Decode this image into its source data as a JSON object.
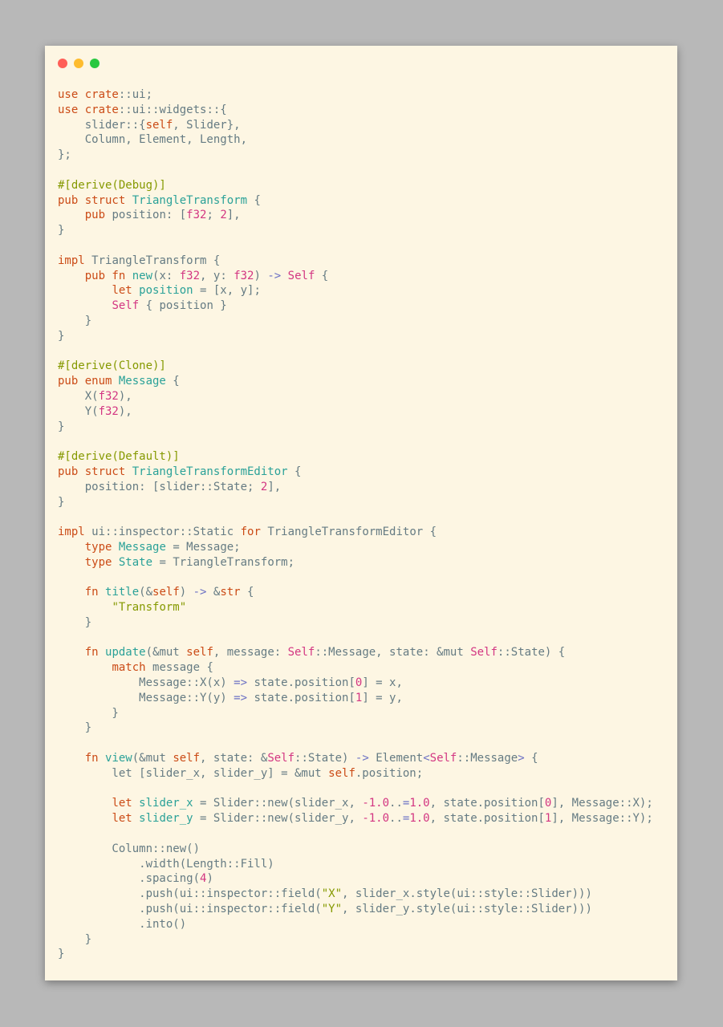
{
  "window": {
    "controls": [
      "close",
      "minimize",
      "maximize"
    ],
    "colors": {
      "close": "#ff5f57",
      "minimize": "#febc2e",
      "maximize": "#28c840",
      "background": "#fdf6e3"
    }
  },
  "code": {
    "language": "rust",
    "lines": [
      [
        [
          "kw",
          "use "
        ],
        [
          "kw",
          "crate"
        ],
        [
          "txt",
          "::ui;"
        ]
      ],
      [
        [
          "kw",
          "use "
        ],
        [
          "kw",
          "crate"
        ],
        [
          "txt",
          "::ui::widgets::{"
        ]
      ],
      [
        [
          "txt",
          "    slider::{"
        ],
        [
          "kw",
          "self"
        ],
        [
          "txt",
          ", Slider},"
        ]
      ],
      [
        [
          "txt",
          "    Column, Element, Length,"
        ]
      ],
      [
        [
          "txt",
          "};"
        ]
      ],
      [],
      [
        [
          "attr",
          "#[derive(Debug)]"
        ]
      ],
      [
        [
          "kw",
          "pub struct "
        ],
        [
          "ty",
          "TriangleTransform"
        ],
        [
          "txt",
          " {"
        ]
      ],
      [
        [
          "txt",
          "    "
        ],
        [
          "kw",
          "pub "
        ],
        [
          "txt",
          "position: ["
        ],
        [
          "num",
          "f32"
        ],
        [
          "txt",
          "; "
        ],
        [
          "num",
          "2"
        ],
        [
          "txt",
          "],"
        ]
      ],
      [
        [
          "txt",
          "}"
        ]
      ],
      [],
      [
        [
          "kw",
          "impl "
        ],
        [
          "txt",
          "TriangleTransform {"
        ]
      ],
      [
        [
          "txt",
          "    "
        ],
        [
          "kw",
          "pub fn "
        ],
        [
          "ty",
          "new"
        ],
        [
          "txt",
          "(x: "
        ],
        [
          "num",
          "f32"
        ],
        [
          "txt",
          ", y: "
        ],
        [
          "num",
          "f32"
        ],
        [
          "txt",
          ") "
        ],
        [
          "op",
          "->"
        ],
        [
          "txt",
          " "
        ],
        [
          "num",
          "Self"
        ],
        [
          "txt",
          " {"
        ]
      ],
      [
        [
          "txt",
          "        "
        ],
        [
          "kw",
          "let "
        ],
        [
          "ty",
          "position"
        ],
        [
          "txt",
          " = [x, y];"
        ]
      ],
      [
        [
          "txt",
          "        "
        ],
        [
          "num",
          "Self"
        ],
        [
          "txt",
          " { position }"
        ]
      ],
      [
        [
          "txt",
          "    }"
        ]
      ],
      [
        [
          "txt",
          "}"
        ]
      ],
      [],
      [
        [
          "attr",
          "#[derive(Clone)]"
        ]
      ],
      [
        [
          "kw",
          "pub enum "
        ],
        [
          "ty",
          "Message"
        ],
        [
          "txt",
          " {"
        ]
      ],
      [
        [
          "txt",
          "    X("
        ],
        [
          "num",
          "f32"
        ],
        [
          "txt",
          "),"
        ]
      ],
      [
        [
          "txt",
          "    Y("
        ],
        [
          "num",
          "f32"
        ],
        [
          "txt",
          "),"
        ]
      ],
      [
        [
          "txt",
          "}"
        ]
      ],
      [],
      [
        [
          "attr",
          "#[derive(Default)]"
        ]
      ],
      [
        [
          "kw",
          "pub struct "
        ],
        [
          "ty",
          "TriangleTransformEditor"
        ],
        [
          "txt",
          " {"
        ]
      ],
      [
        [
          "txt",
          "    position: [slider::State; "
        ],
        [
          "num",
          "2"
        ],
        [
          "txt",
          "],"
        ]
      ],
      [
        [
          "txt",
          "}"
        ]
      ],
      [],
      [
        [
          "kw",
          "impl "
        ],
        [
          "txt",
          "ui::inspector::Static "
        ],
        [
          "kw",
          "for "
        ],
        [
          "txt",
          "TriangleTransformEditor {"
        ]
      ],
      [
        [
          "txt",
          "    "
        ],
        [
          "kw",
          "type "
        ],
        [
          "ty",
          "Message"
        ],
        [
          "txt",
          " = Message;"
        ]
      ],
      [
        [
          "txt",
          "    "
        ],
        [
          "kw",
          "type "
        ],
        [
          "ty",
          "State"
        ],
        [
          "txt",
          " = TriangleTransform;"
        ]
      ],
      [],
      [
        [
          "txt",
          "    "
        ],
        [
          "kw",
          "fn "
        ],
        [
          "ty",
          "title"
        ],
        [
          "txt",
          "(&"
        ],
        [
          "kw",
          "self"
        ],
        [
          "txt",
          ") "
        ],
        [
          "op",
          "->"
        ],
        [
          "txt",
          " &"
        ],
        [
          "kw",
          "str"
        ],
        [
          "txt",
          " {"
        ]
      ],
      [
        [
          "txt",
          "        "
        ],
        [
          "str",
          "\"Transform\""
        ]
      ],
      [
        [
          "txt",
          "    }"
        ]
      ],
      [],
      [
        [
          "txt",
          "    "
        ],
        [
          "kw",
          "fn "
        ],
        [
          "ty",
          "update"
        ],
        [
          "txt",
          "(&mut "
        ],
        [
          "kw",
          "self"
        ],
        [
          "txt",
          ", message: "
        ],
        [
          "num",
          "Self"
        ],
        [
          "txt",
          "::Message, state: &mut "
        ],
        [
          "num",
          "Self"
        ],
        [
          "txt",
          "::State) {"
        ]
      ],
      [
        [
          "txt",
          "        "
        ],
        [
          "kw",
          "match "
        ],
        [
          "txt",
          "message {"
        ]
      ],
      [
        [
          "txt",
          "            Message::X(x) "
        ],
        [
          "op",
          "=>"
        ],
        [
          "txt",
          " state.position["
        ],
        [
          "num",
          "0"
        ],
        [
          "txt",
          "] = x,"
        ]
      ],
      [
        [
          "txt",
          "            Message::Y(y) "
        ],
        [
          "op",
          "=>"
        ],
        [
          "txt",
          " state.position["
        ],
        [
          "num",
          "1"
        ],
        [
          "txt",
          "] = y,"
        ]
      ],
      [
        [
          "txt",
          "        }"
        ]
      ],
      [
        [
          "txt",
          "    }"
        ]
      ],
      [],
      [
        [
          "txt",
          "    "
        ],
        [
          "kw",
          "fn "
        ],
        [
          "ty",
          "view"
        ],
        [
          "txt",
          "(&mut "
        ],
        [
          "kw",
          "self"
        ],
        [
          "txt",
          ", state: &"
        ],
        [
          "num",
          "Self"
        ],
        [
          "txt",
          "::State) "
        ],
        [
          "op",
          "->"
        ],
        [
          "txt",
          " Element"
        ],
        [
          "op",
          "<"
        ],
        [
          "num",
          "Self"
        ],
        [
          "txt",
          "::Message"
        ],
        [
          "op",
          ">"
        ],
        [
          "txt",
          " {"
        ]
      ],
      [
        [
          "txt",
          "        let [slider_x, slider_y] = &mut "
        ],
        [
          "kw",
          "self"
        ],
        [
          "txt",
          ".position;"
        ]
      ],
      [],
      [
        [
          "txt",
          "        "
        ],
        [
          "kw",
          "let "
        ],
        [
          "ty",
          "slider_x"
        ],
        [
          "txt",
          " = Slider::new(slider_x, "
        ],
        [
          "num",
          "-1.0"
        ],
        [
          "txt",
          ".."
        ],
        [
          "op",
          "="
        ],
        [
          "num",
          "1.0"
        ],
        [
          "txt",
          ", state.position["
        ],
        [
          "num",
          "0"
        ],
        [
          "txt",
          "], Message::X);"
        ]
      ],
      [
        [
          "txt",
          "        "
        ],
        [
          "kw",
          "let "
        ],
        [
          "ty",
          "slider_y"
        ],
        [
          "txt",
          " = Slider::new(slider_y, "
        ],
        [
          "num",
          "-1.0"
        ],
        [
          "txt",
          ".."
        ],
        [
          "op",
          "="
        ],
        [
          "num",
          "1.0"
        ],
        [
          "txt",
          ", state.position["
        ],
        [
          "num",
          "1"
        ],
        [
          "txt",
          "], Message::Y);"
        ]
      ],
      [],
      [
        [
          "txt",
          "        Column::new()"
        ]
      ],
      [
        [
          "txt",
          "            .width(Length::Fill)"
        ]
      ],
      [
        [
          "txt",
          "            .spacing("
        ],
        [
          "num",
          "4"
        ],
        [
          "txt",
          ")"
        ]
      ],
      [
        [
          "txt",
          "            .push(ui::inspector::field("
        ],
        [
          "str",
          "\"X\""
        ],
        [
          "txt",
          ", slider_x.style(ui::style::Slider)))"
        ]
      ],
      [
        [
          "txt",
          "            .push(ui::inspector::field("
        ],
        [
          "str",
          "\"Y\""
        ],
        [
          "txt",
          ", slider_y.style(ui::style::Slider)))"
        ]
      ],
      [
        [
          "txt",
          "            .into()"
        ]
      ],
      [
        [
          "txt",
          "    }"
        ]
      ],
      [
        [
          "txt",
          "}"
        ]
      ]
    ]
  }
}
